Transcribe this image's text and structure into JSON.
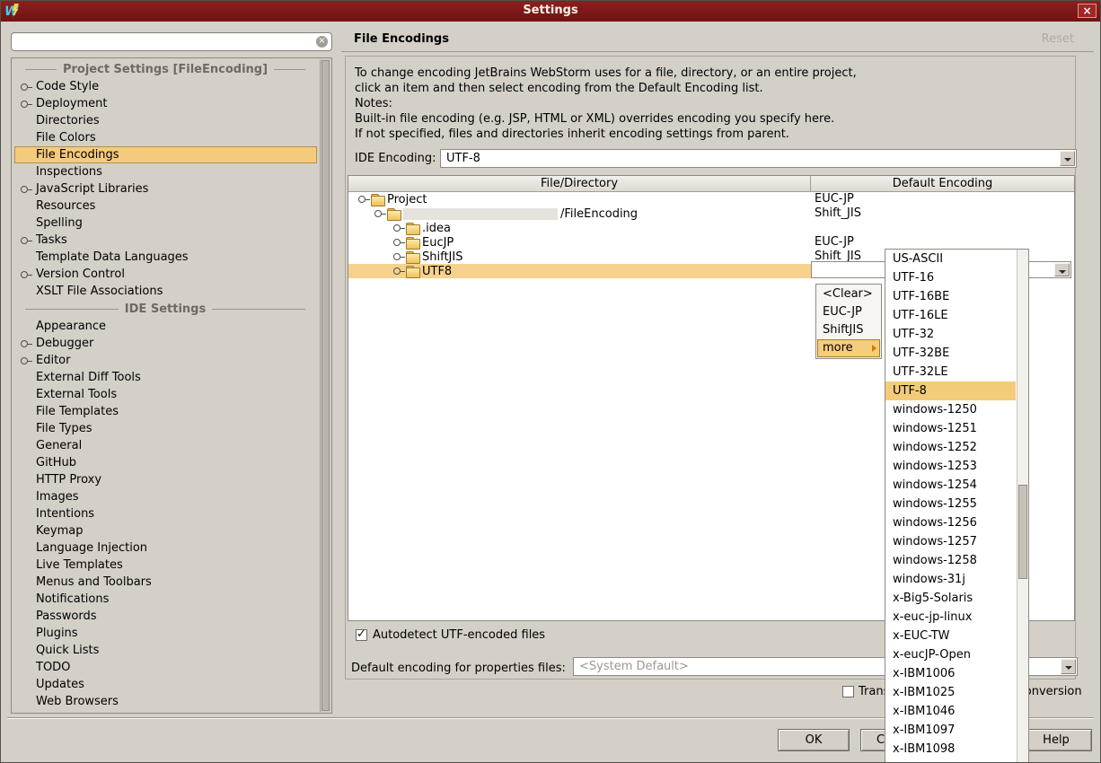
{
  "colors": {
    "titlebar": "#7b1818",
    "selection": "#f4ca7c",
    "row_selection": "#f6d28e"
  },
  "window": {
    "title": "Settings",
    "close": "×"
  },
  "sidebar": {
    "search_value": "",
    "groups": [
      {
        "label": "Project Settings [FileEncoding]",
        "items": [
          {
            "label": "Code Style",
            "expandable": true
          },
          {
            "label": "Deployment",
            "expandable": true
          },
          {
            "label": "Directories"
          },
          {
            "label": "File Colors"
          },
          {
            "label": "File Encodings",
            "selected": true
          },
          {
            "label": "Inspections"
          },
          {
            "label": "JavaScript Libraries",
            "expandable": true
          },
          {
            "label": "Resources"
          },
          {
            "label": "Spelling"
          },
          {
            "label": "Tasks",
            "expandable": true
          },
          {
            "label": "Template Data Languages"
          },
          {
            "label": "Version Control",
            "expandable": true
          },
          {
            "label": "XSLT File Associations"
          }
        ]
      },
      {
        "label": "IDE Settings",
        "items": [
          {
            "label": "Appearance"
          },
          {
            "label": "Debugger",
            "expandable": true
          },
          {
            "label": "Editor",
            "expandable": true
          },
          {
            "label": "External Diff Tools"
          },
          {
            "label": "External Tools"
          },
          {
            "label": "File Templates"
          },
          {
            "label": "File Types"
          },
          {
            "label": "General"
          },
          {
            "label": "GitHub"
          },
          {
            "label": "HTTP Proxy"
          },
          {
            "label": "Images"
          },
          {
            "label": "Intentions"
          },
          {
            "label": "Keymap"
          },
          {
            "label": "Language Injection"
          },
          {
            "label": "Live Templates"
          },
          {
            "label": "Menus and Toolbars"
          },
          {
            "label": "Notifications"
          },
          {
            "label": "Passwords"
          },
          {
            "label": "Plugins"
          },
          {
            "label": "Quick Lists"
          },
          {
            "label": "TODO"
          },
          {
            "label": "Updates"
          },
          {
            "label": "Web Browsers"
          }
        ]
      }
    ]
  },
  "main": {
    "title": "File Encodings",
    "reset": "Reset",
    "description": [
      "To change encoding JetBrains WebStorm uses for a file, directory, or an entire project,",
      "click an item and then select encoding from the Default Encoding list.",
      "Notes:",
      "Built-in file encoding (e.g. JSP, HTML or XML) overrides encoding you specify here.",
      "If not specified, files and directories inherit encoding settings from parent."
    ],
    "ide_encoding_label": "IDE Encoding:",
    "ide_encoding_value": "UTF-8",
    "table": {
      "columns": [
        "File/Directory",
        "Default Encoding"
      ],
      "rows": [
        {
          "name": "Project",
          "encoding": "EUC-JP",
          "level": 0
        },
        {
          "name": "/FileEncoding",
          "encoding": "Shift_JIS",
          "level": 1,
          "redacted": true
        },
        {
          "name": ".idea",
          "encoding": "",
          "level": 2
        },
        {
          "name": "EucJP",
          "encoding": "EUC-JP",
          "level": 2
        },
        {
          "name": "ShiftJIS",
          "encoding": "Shift_JIS",
          "level": 2
        },
        {
          "name": "UTF8",
          "encoding": "",
          "level": 2,
          "selected": true
        }
      ]
    },
    "encoding_menu": {
      "items": [
        "<Clear>",
        "EUC-JP",
        "ShiftJIS",
        "more"
      ],
      "highlighted": "more"
    },
    "encodings_list": {
      "items": [
        "US-ASCII",
        "UTF-16",
        "UTF-16BE",
        "UTF-16LE",
        "UTF-32",
        "UTF-32BE",
        "UTF-32LE",
        "UTF-8",
        "windows-1250",
        "windows-1251",
        "windows-1252",
        "windows-1253",
        "windows-1254",
        "windows-1255",
        "windows-1256",
        "windows-1257",
        "windows-1258",
        "windows-31j",
        "x-Big5-Solaris",
        "x-euc-jp-linux",
        "x-EUC-TW",
        "x-eucJP-Open",
        "x-IBM1006",
        "x-IBM1025",
        "x-IBM1046",
        "x-IBM1097",
        "x-IBM1098"
      ],
      "selected": "UTF-8"
    },
    "autodetect_label": "Autodetect UTF-encoded files",
    "autodetect_checked": true,
    "properties_label": "Default encoding for properties files:",
    "properties_value": "<System Default>",
    "transparent_label": "Transparent native-to-ascii conversion",
    "transparent_checked": false
  },
  "footer": {
    "ok": "OK",
    "cancel": "Cancel",
    "help": "Help"
  }
}
